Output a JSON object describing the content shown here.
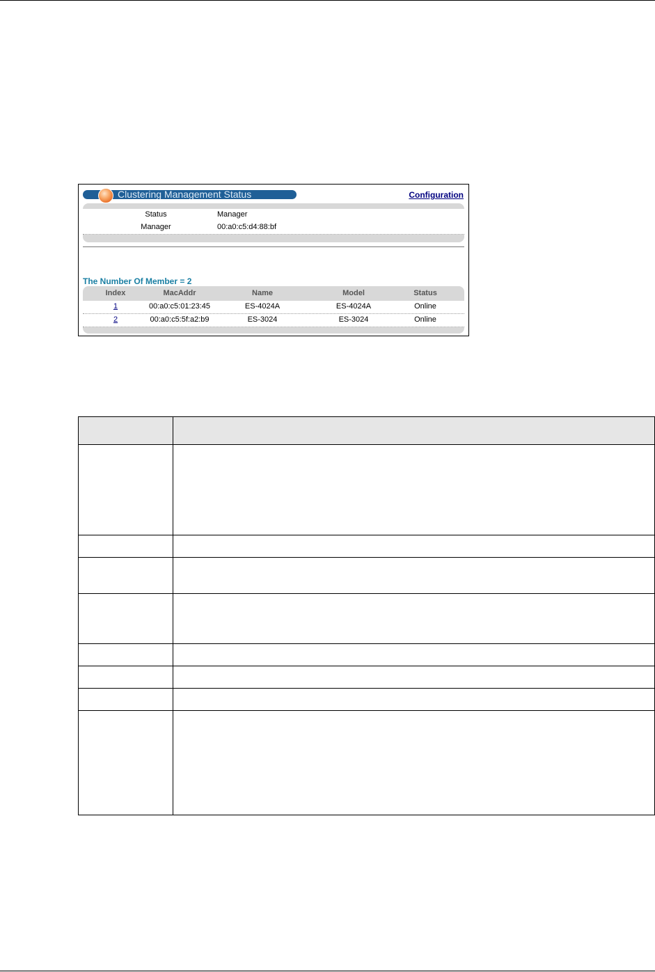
{
  "panel": {
    "title": "Clustering Management Status",
    "configuration_link": "Configuration",
    "info": [
      {
        "label": "Status",
        "value": "Manager"
      },
      {
        "label": "Manager",
        "value": "00:a0:c5:d4:88:bf"
      }
    ],
    "member_count_label": "The Number Of Member = 2",
    "members_table": {
      "headers": [
        "Index",
        "MacAddr",
        "Name",
        "Model",
        "Status"
      ],
      "rows": [
        {
          "index": "1",
          "mac": "00:a0:c5:01:23:45",
          "name": "ES-4024A",
          "model": "ES-4024A",
          "status": "Online"
        },
        {
          "index": "2",
          "mac": "00:a0:c5:5f:a2:b9",
          "name": "ES-3024",
          "model": "ES-3024",
          "status": "Online"
        }
      ]
    }
  },
  "colors": {
    "title_bar": "#1f5f97",
    "title_orb": "#f08a3c",
    "member_count_text": "#1a7fa3",
    "link": "#000080",
    "panel_box": "#d8d8d8",
    "table_header_bg": "#e6e6e6"
  },
  "icons": {
    "title_orb": "orange-orb-icon"
  }
}
